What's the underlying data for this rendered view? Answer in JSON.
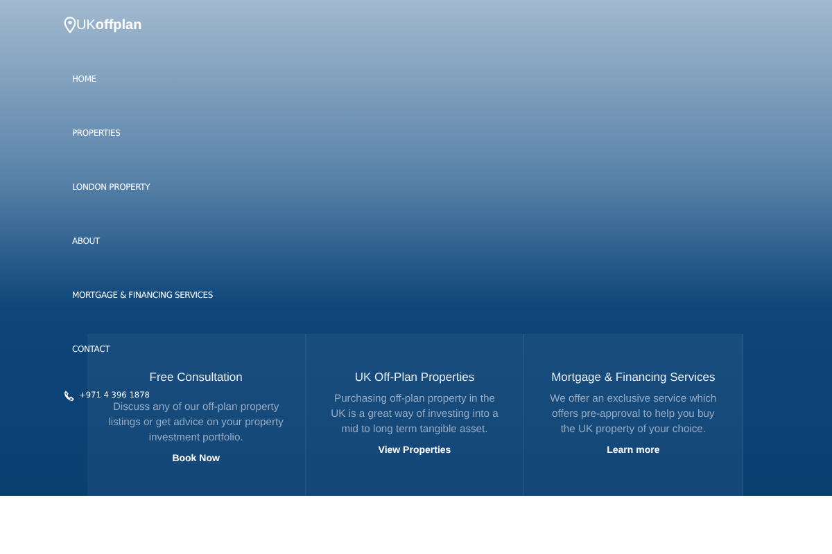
{
  "logo": {
    "prefix": "UK",
    "name": "offplan"
  },
  "nav": [
    {
      "label": "HOME"
    },
    {
      "label": "PROPERTIES"
    },
    {
      "label": "LONDON PROPERTY"
    },
    {
      "label": "ABOUT"
    },
    {
      "label": "MORTGAGE & FINANCING SERVICES"
    },
    {
      "label": "CONTACT"
    }
  ],
  "phone": "+971 4 396 1878",
  "cards": [
    {
      "title": "Free Consultation",
      "text": "Discuss any of our off-plan property listings or get advice on your property investment portfolio.",
      "link": "Book Now"
    },
    {
      "title": "UK Off-Plan Properties",
      "text": "Purchasing off-plan property in the UK is a great way of investing into a mid to long term tangible asset.",
      "link": "View Properties"
    },
    {
      "title": "Mortgage & Financing Services",
      "text": "We offer an exclusive service which offers pre-approval to help you buy the UK property of your choice.",
      "link": "Learn more"
    }
  ]
}
